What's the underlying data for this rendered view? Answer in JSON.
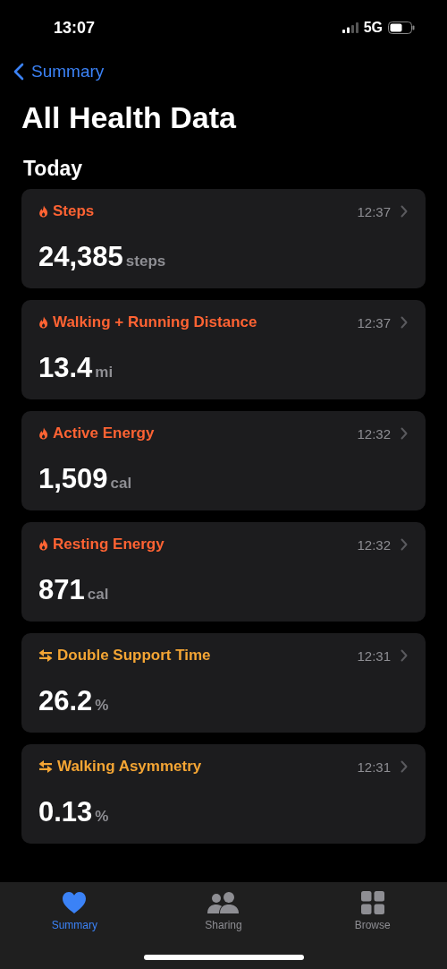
{
  "status_bar": {
    "time": "13:07",
    "network": "5G"
  },
  "nav": {
    "back_label": "Summary"
  },
  "title": "All Health Data",
  "section": "Today",
  "cards": [
    {
      "kind": "flame",
      "color": "#ff6333",
      "title": "Steps",
      "time": "12:37",
      "value": "24,385",
      "unit": "steps"
    },
    {
      "kind": "flame",
      "color": "#ff6333",
      "title": "Walking + Running Distance",
      "time": "12:37",
      "value": "13.4",
      "unit": "mi"
    },
    {
      "kind": "flame",
      "color": "#ff6333",
      "title": "Active Energy",
      "time": "12:32",
      "value": "1,509",
      "unit": "cal"
    },
    {
      "kind": "flame",
      "color": "#ff6333",
      "title": "Resting Energy",
      "time": "12:32",
      "value": "871",
      "unit": "cal"
    },
    {
      "kind": "arrows",
      "color": "#f4a534",
      "title": "Double Support Time",
      "time": "12:31",
      "value": "26.2",
      "unit": "%"
    },
    {
      "kind": "arrows",
      "color": "#f4a534",
      "title": "Walking Asymmetry",
      "time": "12:31",
      "value": "0.13",
      "unit": "%"
    }
  ],
  "tabs": [
    {
      "kind": "heart",
      "label": "Summary",
      "selected": true
    },
    {
      "kind": "people",
      "label": "Sharing",
      "selected": false
    },
    {
      "kind": "grid",
      "label": "Browse",
      "selected": false
    }
  ]
}
